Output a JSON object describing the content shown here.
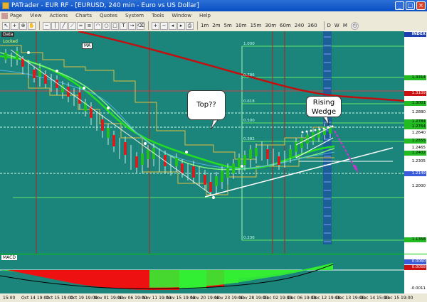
{
  "window": {
    "title": "PATrader - EUR RF - [EURUSD, 240 min - Euro vs US Dollar]"
  },
  "menu": [
    "Page",
    "View",
    "Actions",
    "Charts",
    "Quotes",
    "System",
    "Tools",
    "Window",
    "Help"
  ],
  "toolbar": {
    "timeframes": [
      "1m",
      "2m",
      "5m",
      "10m",
      "15m",
      "30m",
      "60m",
      "240",
      "360",
      "D",
      "W",
      "M"
    ]
  },
  "chart": {
    "tabs": [
      "Data",
      "Locked"
    ],
    "indicator_tag": "MA",
    "index_label": "INDEX",
    "fib_levels": [
      "1.000",
      "0.786",
      "0.618",
      "0.500",
      "0.382",
      "0.236"
    ],
    "price_labels": [
      "1.3314",
      "1.3109",
      "1.3001",
      "1.2880",
      "1.2784",
      "1.2764",
      "1.2640",
      "1.2555",
      "1.2465",
      "1.2402",
      "1.2305",
      "1.2149",
      "1.2000",
      "1.1358"
    ],
    "annotations": {
      "top": "Top??",
      "rising": "Rising",
      "wedge": "Wedge"
    },
    "colors": {
      "background": "#1c857b",
      "ma_red": "#c01010",
      "ma_green": "#22dd22",
      "trend": "#ffffff",
      "projection": "#cc33cc"
    }
  },
  "macd": {
    "label": "MACD",
    "values": [
      "0.0060",
      "0.0058",
      "-0.0011"
    ]
  },
  "time_axis": [
    "15:00",
    "Oct 14 19:00",
    "Oct 15 19:00",
    "Oct 19 19:00",
    "Nov 01 19:00",
    "Nov 06 19:00",
    "Nov 11 19:00",
    "Nov 15 19:00",
    "Nov 20 19:00",
    "Nov 23 19:00",
    "Nov 28 19:00",
    "Dec 02 19:00",
    "Dec 06 19:00",
    "Dec 12 19:00",
    "Dec 13 19:00",
    "Dec 14 15:00",
    "Dec 15 19:00"
  ]
}
